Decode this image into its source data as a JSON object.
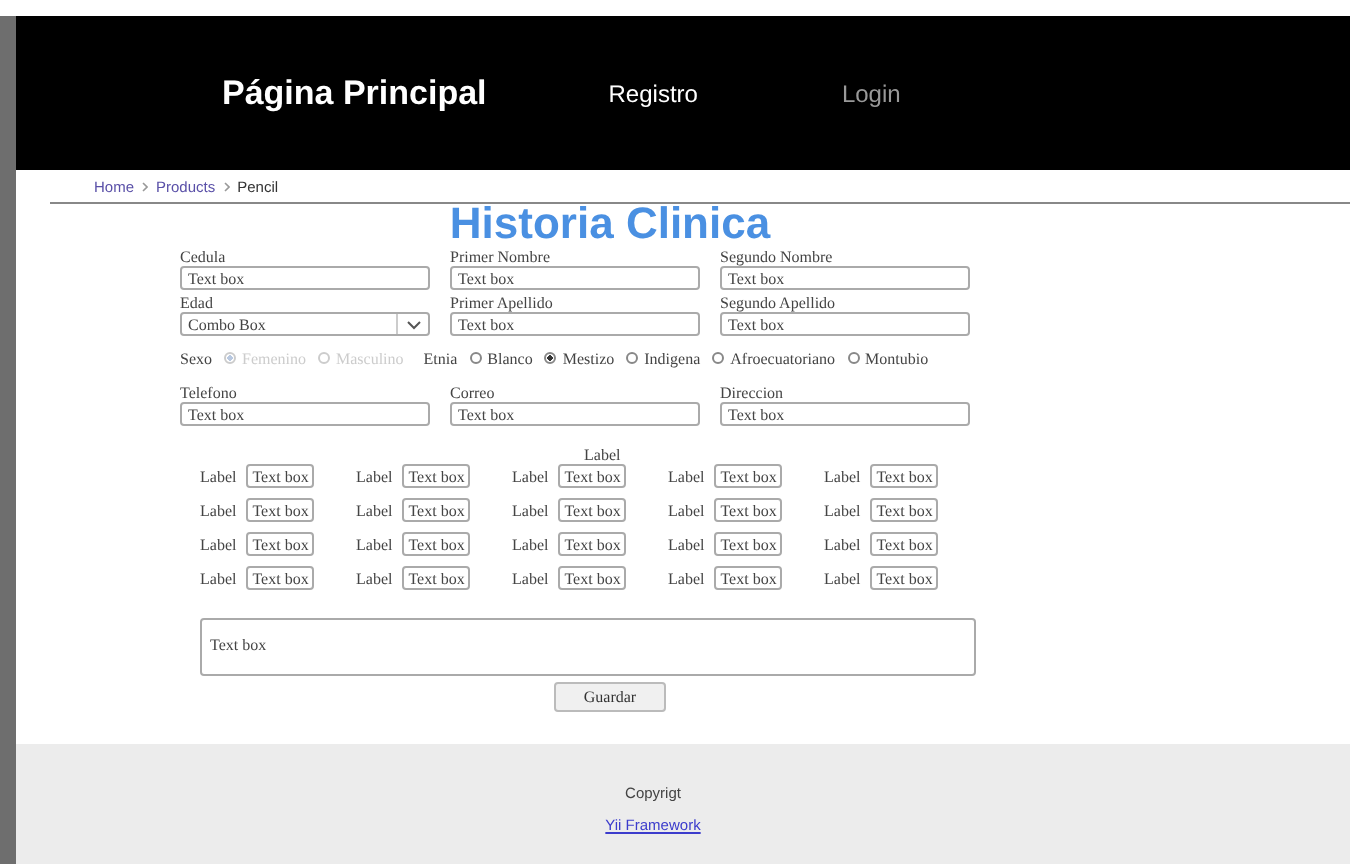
{
  "header": {
    "title": "Página Principal",
    "nav": [
      {
        "label": "Registro",
        "selected": true
      },
      {
        "label": "Login",
        "selected": false
      }
    ]
  },
  "breadcrumb": [
    "Home",
    "Products",
    "Pencil"
  ],
  "form": {
    "title": "Historia Clinica",
    "fields": [
      {
        "label": "Cedula",
        "value": "Text box",
        "kind": "text"
      },
      {
        "label": "Primer Nombre",
        "value": "Text box",
        "kind": "text"
      },
      {
        "label": "Segundo Nombre",
        "value": "Text box",
        "kind": "text"
      },
      {
        "label": "Edad",
        "value": "Combo Box",
        "kind": "combo"
      },
      {
        "label": "Primer Apellido",
        "value": "Text box",
        "kind": "text"
      },
      {
        "label": "Segundo Apellido",
        "value": "Text box",
        "kind": "text"
      }
    ],
    "radio_groups": [
      {
        "label": "Sexo",
        "options": [
          {
            "label": "Femenino",
            "selected": true,
            "disabled": true
          },
          {
            "label": "Masculino",
            "selected": false,
            "disabled": true
          }
        ]
      },
      {
        "label": "Etnia",
        "options": [
          {
            "label": "Blanco",
            "selected": false,
            "disabled": false
          },
          {
            "label": "Mestizo",
            "selected": true,
            "disabled": false
          },
          {
            "label": "Indigena",
            "selected": false,
            "disabled": false
          },
          {
            "label": "Afroecuatoriano",
            "selected": false,
            "disabled": false
          },
          {
            "label": "Montubio",
            "selected": false,
            "disabled": false
          }
        ]
      }
    ],
    "fields2": [
      {
        "label": "Telefono",
        "value": "Text box",
        "kind": "text"
      },
      {
        "label": "Correo",
        "value": "Text box",
        "kind": "text"
      },
      {
        "label": "Direccion",
        "value": "Text box",
        "kind": "text"
      }
    ],
    "grid_heading": "Label",
    "grid": [
      [
        {
          "label": "Label",
          "value": "Text box"
        },
        {
          "label": "Label",
          "value": "Text box"
        },
        {
          "label": "Label",
          "value": "Text box"
        },
        {
          "label": "Label",
          "value": "Text box"
        },
        {
          "label": "Label",
          "value": "Text box"
        }
      ],
      [
        {
          "label": "Label",
          "value": "Text box"
        },
        {
          "label": "Label",
          "value": "Text box"
        },
        {
          "label": "Label",
          "value": "Text box"
        },
        {
          "label": "Label",
          "value": "Text box"
        },
        {
          "label": "Label",
          "value": "Text box"
        }
      ],
      [
        {
          "label": "Label",
          "value": "Text box"
        },
        {
          "label": "Label",
          "value": "Text box"
        },
        {
          "label": "Label",
          "value": "Text box"
        },
        {
          "label": "Label",
          "value": "Text box"
        },
        {
          "label": "Label",
          "value": "Text box"
        }
      ],
      [
        {
          "label": "Label",
          "value": "Text box"
        },
        {
          "label": "Label",
          "value": "Text box"
        },
        {
          "label": "Label",
          "value": "Text box"
        },
        {
          "label": "Label",
          "value": "Text box"
        },
        {
          "label": "Label",
          "value": "Text box"
        }
      ]
    ],
    "notes": "Text box",
    "submit": "Guardar"
  },
  "footer": {
    "text": "Copyrigt",
    "link": "Yii Framework"
  }
}
